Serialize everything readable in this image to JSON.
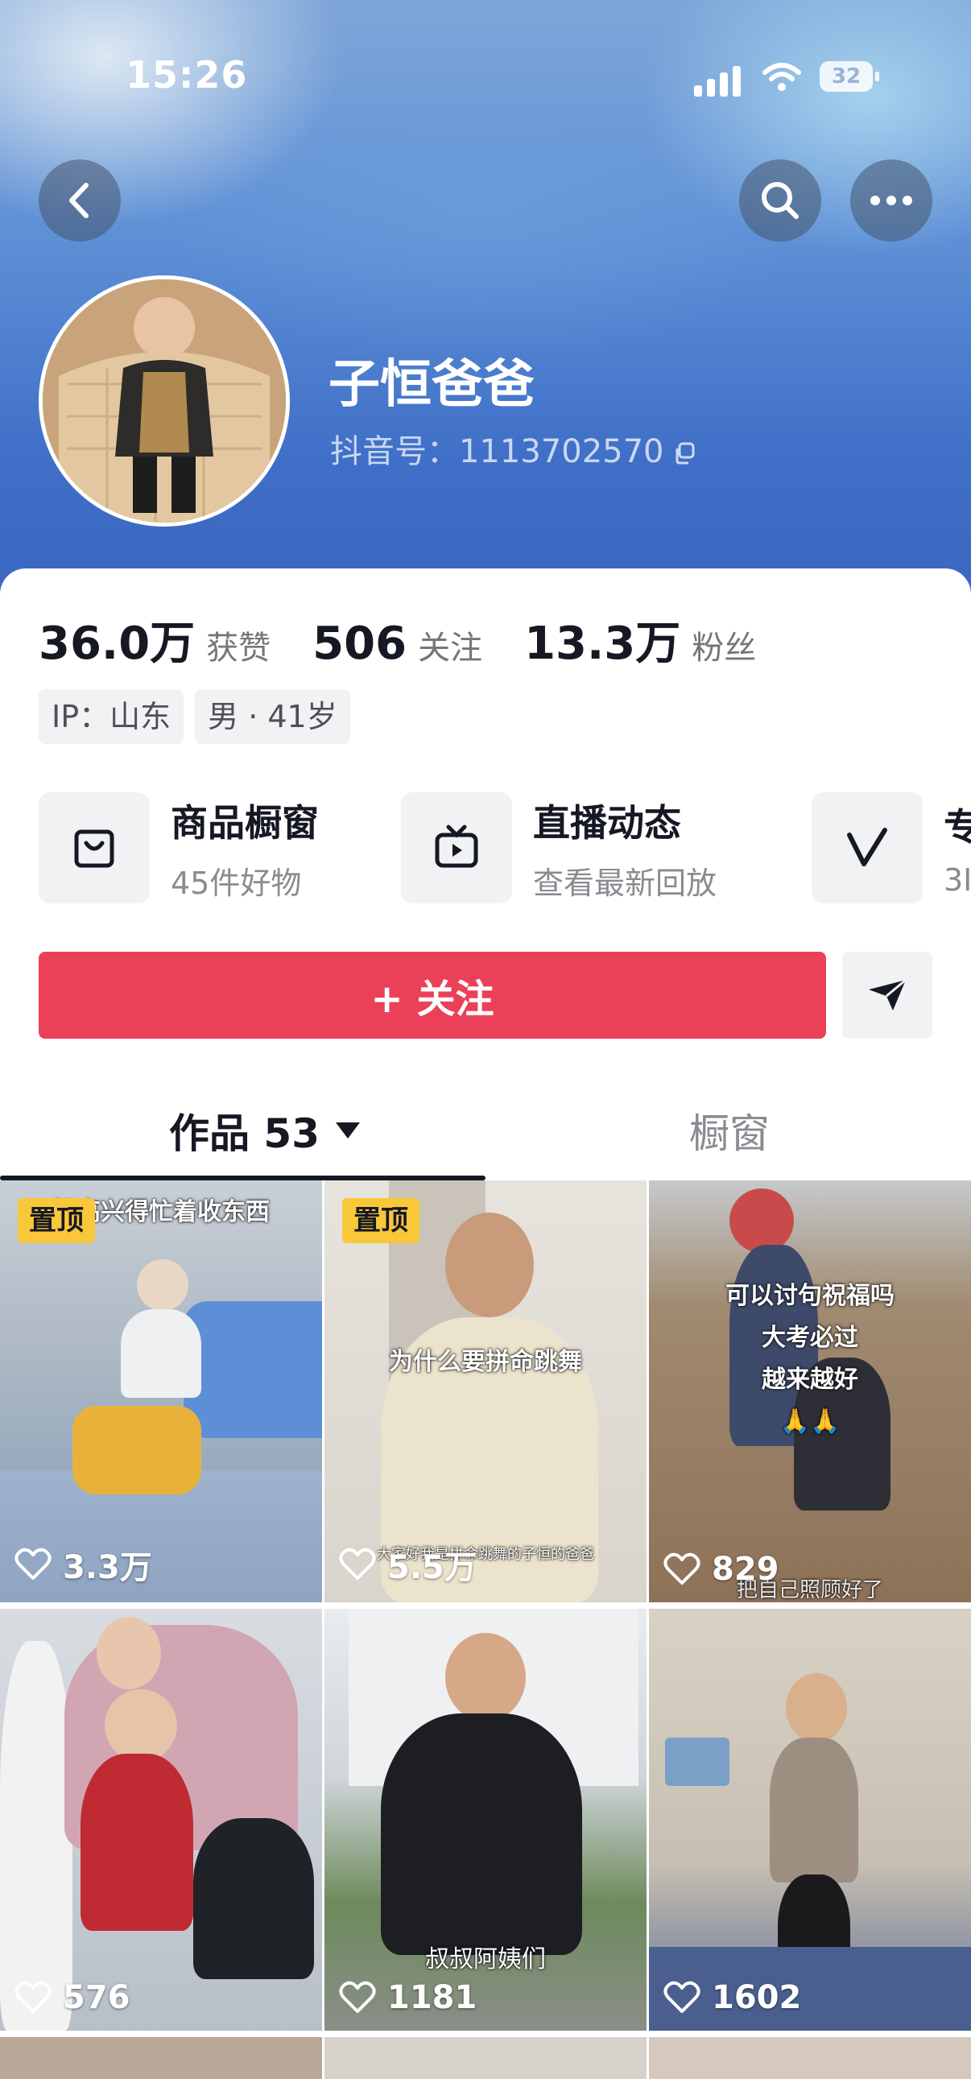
{
  "status_bar": {
    "time": "15:26",
    "battery": "32"
  },
  "profile": {
    "nickname": "子恒爸爸",
    "douyin_id": "抖音号：1113702570"
  },
  "stats": [
    {
      "value": "36.0万",
      "label": "获赞"
    },
    {
      "value": "506",
      "label": "关注"
    },
    {
      "value": "13.3万",
      "label": "粉丝"
    }
  ],
  "tags": [
    "IP：山东",
    "男 · 41岁"
  ],
  "entries": [
    {
      "title": "商品橱窗",
      "subtitle": "45件好物",
      "icon": "shopping-bag-icon"
    },
    {
      "title": "直播动态",
      "subtitle": "查看最新回放",
      "icon": "tv-icon"
    },
    {
      "title": "专",
      "subtitle": "3I",
      "icon": "v-logo-icon"
    }
  ],
  "actions": {
    "follow_label": "+ 关注"
  },
  "tabs": {
    "works_label": "作品 53",
    "window_label": "橱窗"
  },
  "videos": [
    {
      "pinned": true,
      "pin_label": "置顶",
      "likes": "3.3万",
      "caption_top": "把高兴得忙着收东西",
      "caption_mid": "",
      "caption_bottom": ""
    },
    {
      "pinned": true,
      "pin_label": "置顶",
      "likes": "5.5万",
      "caption_top": "",
      "caption_mid": "为什么要拼命跳舞",
      "caption_bottom": "大家好我是拼命跳舞的子恒的爸爸"
    },
    {
      "pinned": false,
      "pin_label": "",
      "likes": "829",
      "caption_top": "",
      "caption_mid": "可以讨句祝福吗\n大考必过\n越来越好\n🙏🙏",
      "caption_bottom": "把自己照顾好了"
    },
    {
      "pinned": false,
      "pin_label": "",
      "likes": "576",
      "caption_top": "",
      "caption_mid": "",
      "caption_bottom": ""
    },
    {
      "pinned": false,
      "pin_label": "",
      "likes": "1181",
      "caption_top": "",
      "caption_mid": "",
      "caption_bottom": "叔叔阿姨们"
    },
    {
      "pinned": false,
      "pin_label": "",
      "likes": "1602",
      "caption_top": "",
      "caption_mid": "",
      "caption_bottom": ""
    }
  ],
  "colors": {
    "accent": "#ea4159",
    "pin": "#f9c73a",
    "banner": "#4a78c9"
  }
}
